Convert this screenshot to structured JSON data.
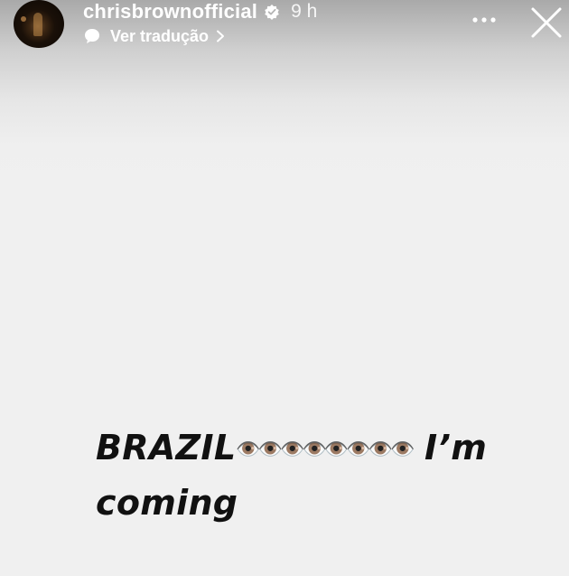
{
  "story": {
    "username": "chrisbrownofficial",
    "verified": true,
    "time_ago": "9 h",
    "translate_label": "Ver tradução",
    "caption": {
      "word1": "BRAZIL",
      "eyes": "👁️👁️👁️👁️👁️👁️👁️👁️",
      "word2": " I’m",
      "line2": "coming"
    }
  },
  "icons": {
    "verified": "verified-badge-icon",
    "translate": "speech-bubble-icon",
    "chevron": "chevron-right-icon",
    "more": "more-horizontal-icon",
    "close": "close-icon"
  },
  "colors": {
    "header_text": "#ffffff",
    "caption_text": "#111111",
    "background": "#f0f0f0"
  }
}
